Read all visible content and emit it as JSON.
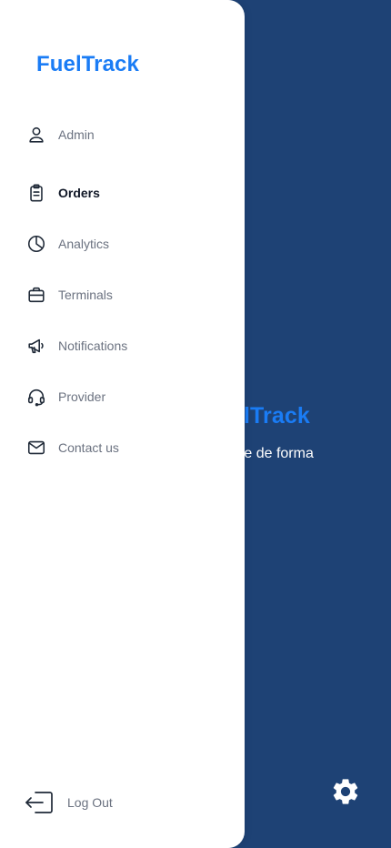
{
  "app": {
    "brand": "FuelTrack"
  },
  "background": {
    "brand_fragment": "elTrack",
    "line1": "ustible de forma",
    "line2": "."
  },
  "drawer": {
    "brand": "FuelTrack",
    "items": [
      {
        "label": "Admin",
        "icon": "user-icon",
        "active": false
      },
      {
        "label": "Orders",
        "icon": "clipboard-icon",
        "active": true
      },
      {
        "label": "Analytics",
        "icon": "pie-chart-icon",
        "active": false
      },
      {
        "label": "Terminals",
        "icon": "briefcase-icon",
        "active": false
      },
      {
        "label": "Notifications",
        "icon": "megaphone-icon",
        "active": false
      },
      {
        "label": "Provider",
        "icon": "headset-icon",
        "active": false
      },
      {
        "label": "Contact us",
        "icon": "mail-icon",
        "active": false
      }
    ],
    "logout_label": "Log Out"
  },
  "colors": {
    "brand": "#1a7cf5",
    "background": "#1e4275",
    "drawer": "#ffffff",
    "label": "#6b7280",
    "label_active": "#111827"
  }
}
